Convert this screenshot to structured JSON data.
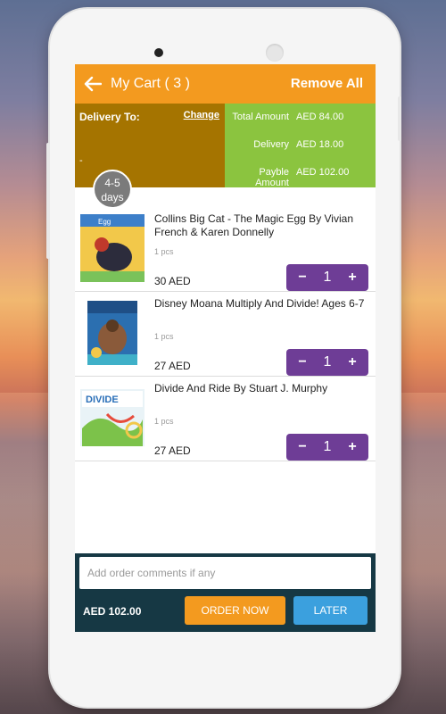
{
  "header": {
    "title": "My Cart ( 3 )",
    "remove_all": "Remove All",
    "back_icon": "arrow-left-icon"
  },
  "delivery": {
    "label": "Delivery To:",
    "change": "Change",
    "address": "-"
  },
  "amounts": {
    "total_label": "Total Amount",
    "total_value": "AED 84.00",
    "delivery_label": "Delivery",
    "delivery_value": "AED 18.00",
    "payable_label": "Payble Amount",
    "payable_value": "AED 102.00"
  },
  "delivery_days": {
    "line1": "4-5",
    "line2": "days"
  },
  "cart": {
    "items": [
      {
        "name": "Collins Big Cat - The Magic Egg By Vivian French & Karen Donnelly",
        "pcs": "1 pcs",
        "price": "30 AED",
        "qty": "1"
      },
      {
        "name": "Disney Moana Multiply And Divide! Ages 6-7",
        "pcs": "1 pcs",
        "price": "27 AED",
        "qty": "1"
      },
      {
        "name": "Divide And Ride By Stuart J. Murphy",
        "pcs": "1 pcs",
        "price": "27 AED",
        "qty": "1"
      }
    ],
    "minus": "−",
    "plus": "+"
  },
  "footer": {
    "comment_placeholder": "Add order comments if any",
    "total": "AED 102.00",
    "order_now": "ORDER NOW",
    "later": "LATER"
  },
  "colors": {
    "header": "#f39a1f",
    "delivery_box": "#a57400",
    "amount_box": "#8bc43f",
    "stepper": "#6e3d96",
    "footer": "#163844",
    "later": "#3ba0de"
  }
}
